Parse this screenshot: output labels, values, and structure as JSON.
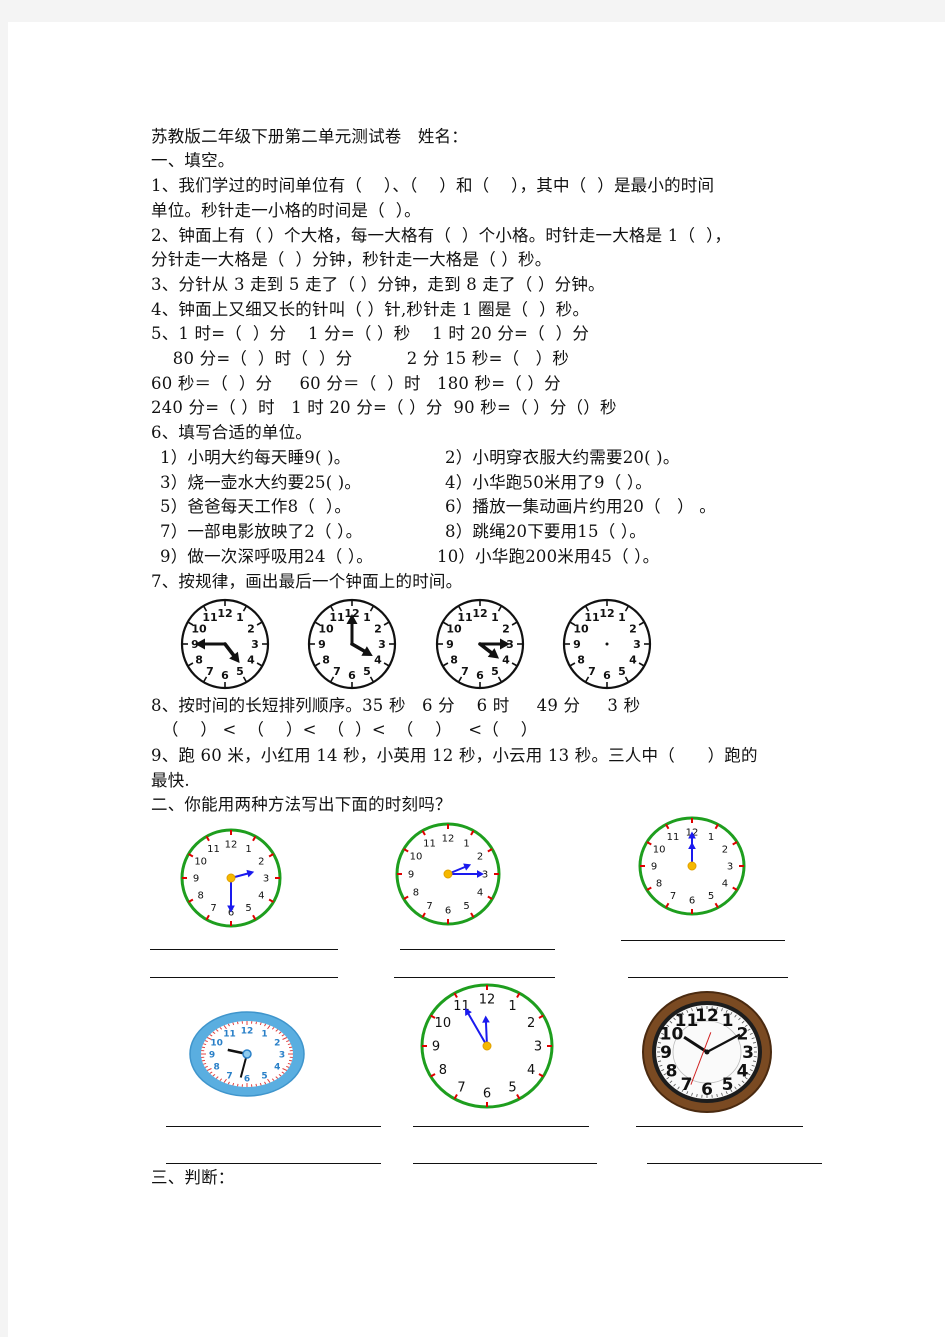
{
  "title": "苏教版二年级下册第二单元测试卷",
  "name_label": "姓名：",
  "section1": {
    "heading": "一、填空。",
    "q1_line1": "1、我们学过的时间单位有（    ）、（    ）和（    ），其中（  ）是最小的时间",
    "q1_line2": "单位。秒针走一小格的时间是（  ）。",
    "q2_line1": "2、钟面上有（ ）个大格，每一大格有（  ）个小格。时针走一大格是 1（  ），",
    "q2_line2": "分针走一大格是（  ）分钟，秒针走一大格是（ ）秒。",
    "q3": "3、分针从 3 走到 5 走了（ ）分钟，走到 8 走了（ ）分钟。",
    "q4": "4、钟面上又细又长的针叫（ ）针,秒针走 1 圈是（  ）秒。",
    "q5_line1": "5、1 时=（  ）分    1 分=（ ）秒    1 时 20 分=（  ）分",
    "q5_line2": "    80 分=（  ）时（  ）分          2 分 15 秒=（   ）秒",
    "q5_line3": "60 秒＝（  ）分     60 分＝（  ）时   180 秒=（ ）分",
    "q5_line4": "240 分=（ ）时   1 时 20 分=（ ）分  90 秒=（ ）分（）秒",
    "q6_heading": "6、填写合适的单位。",
    "q6_items": [
      "1）小明大约每天睡9( )。",
      "2）小明穿衣服大约需要20( )。",
      "3）烧一壶水大约要25( )。",
      "4）小华跑50米用了9（ ）。",
      "5）爸爸每天工作8（  ）。",
      "6）播放一集动画片约用20（   ） 。",
      "7）一部电影放映了2（ ）。",
      "8）跳绳20下要用15（ ）。",
      "9）做一次深呼吸用24（ ）。",
      "10）小华跑200米用45（ ）。"
    ],
    "q7": "7、按规律，画出最后一个钟面上的时间。",
    "q7_clocks": [
      {
        "hour": 4,
        "minute": 45,
        "note": "hour hand near 4, minute hand at 9"
      },
      {
        "hour": 4,
        "minute": 0,
        "note": "minute hand at 12, hour hand at 4"
      },
      {
        "hour": 4,
        "minute": 15,
        "note": "minute hand at 3, hour hand near 4"
      },
      {
        "hour": null,
        "minute": null,
        "note": "blank - to be drawn"
      }
    ],
    "q8_line1": "8、按时间的长短排列顺序。35 秒   6 分    6 时     49 分     3 秒",
    "q8_line2": "  （    ） <  （    ）<  （  ）<  （    ）   <（    ）",
    "q9_line1": "9、跑 60 米，小红用 14 秒，小英用 12 秒，小云用 13 秒。三人中（      ）跑的",
    "q9_line2": "最快."
  },
  "section2": {
    "heading": "二、你能用两种方法写出下面的时刻吗？",
    "clocks": [
      {
        "style": "green",
        "hour": 2,
        "minute": 30
      },
      {
        "style": "green",
        "hour": 2,
        "minute": 15
      },
      {
        "style": "green",
        "hour": 12,
        "minute": 0
      },
      {
        "style": "blue-oval",
        "hour": 9,
        "minute": 32
      },
      {
        "style": "green",
        "hour": 11,
        "minute": 55
      },
      {
        "style": "wood-wall",
        "hour": 10,
        "minute": 10
      }
    ]
  },
  "section3": {
    "heading": "三、判断："
  },
  "colors": {
    "green_rim": "#1e9e1e",
    "tick_red": "#e00000",
    "hand_blue": "#1a1aee",
    "center_gold": "#f5b800",
    "oval_blue": "#5aaee0",
    "wood": "#7a4a22"
  }
}
